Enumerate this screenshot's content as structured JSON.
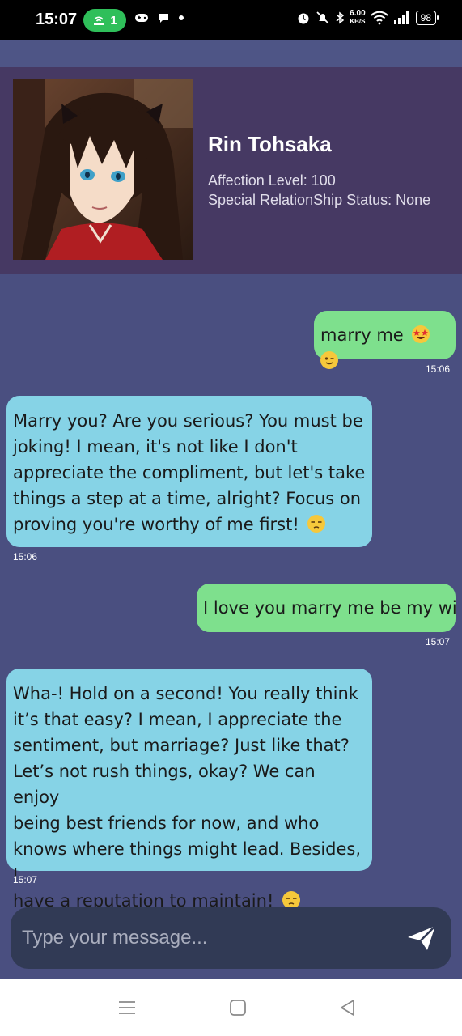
{
  "status_bar": {
    "time": "15:07",
    "hotspot_count": "1",
    "net_speed_value": "6.00",
    "net_speed_unit": "KB/S",
    "battery": "98"
  },
  "profile": {
    "name": "Rin Tohsaka",
    "affection": "Affection Level: 100",
    "relationship": "Special RelationShip Status: None"
  },
  "messages": [
    {
      "text": "marry me",
      "time": "15:06",
      "emojis": [
        "star-struck-emoji",
        "winking-face-emoji"
      ]
    },
    {
      "lines": [
        "Marry you? Are you serious? You must be",
        "joking! I mean, it's not like I don't",
        "appreciate the compliment, but let's take",
        "things a step at a time, alright? Focus on",
        "proving you're worthy of me first!"
      ],
      "time": "15:06",
      "emoji": "unamused-face-emoji"
    },
    {
      "text": "I love you marry me be my wif",
      "time": "15:07"
    },
    {
      "lines": [
        "Wha-! Hold on a second! You really think",
        "it’s that easy? I mean, I appreciate the",
        "sentiment, but marriage? Just like that?",
        "Let’s not rush things, okay? We can enjoy",
        "being best friends for now, and who",
        "knows where things might lead. Besides, I",
        "have a reputation to maintain!"
      ],
      "time": "15:07",
      "emoji": "unamused-face-emoji"
    }
  ],
  "input": {
    "placeholder": "Type your message..."
  },
  "colors": {
    "background": "#4a4f80",
    "header": "#463963",
    "sent_bubble": "#7ee08d",
    "received_bubble": "#86d3e6",
    "input_bg": "#313a55"
  }
}
